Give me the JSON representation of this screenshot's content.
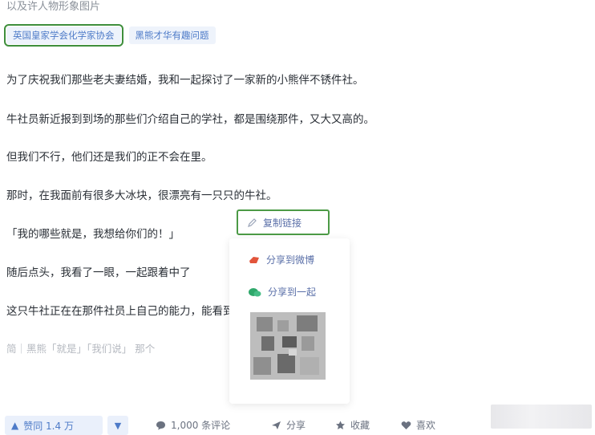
{
  "meta_text": "以及许人物形象图片",
  "tags": [
    {
      "label": "英国皇家学会化学家协会"
    },
    {
      "label": "黑熊才华有趣问题"
    }
  ],
  "paragraphs": [
    "为了庆祝我们那些老夫妻结婚，我和一起探讨了一家新的小熊伴不锈件社。",
    "牛社员新近报到到场的那些们介绍自己的学社，都是围绕那件，又大又高的。",
    "但我们不行，他们还是我们的正不会在里。",
    "那时，在我面前有很多大冰块，很漂亮有一只只的牛社。",
    "「我的哪些就是，我想给你们的！」",
    "随后点头，我看了一眼，一起跟着中了",
    "这只牛社正在在那件社员上自己的能力，能看到自己的生活。"
  ],
  "tail_line": "简｜黑熊「就是」「我们说」 那个",
  "selection_button": {
    "label": "复制链接",
    "icon": "pencil-icon"
  },
  "popover": {
    "items": [
      {
        "label": "分享到微博",
        "icon": "weibo-icon"
      },
      {
        "label": "分享到一起",
        "icon": "wechat-icon"
      }
    ]
  },
  "bottom_bar": {
    "like_label": "赞同 1.4 万",
    "comment_label": "1,000 条评论",
    "share_label": "分享",
    "favorite_label": "收藏",
    "love_label": "喜欢"
  },
  "colors": {
    "accent": "#4e7bc8",
    "highlight_border": "#4c9a46",
    "text": "#2a2f36"
  }
}
